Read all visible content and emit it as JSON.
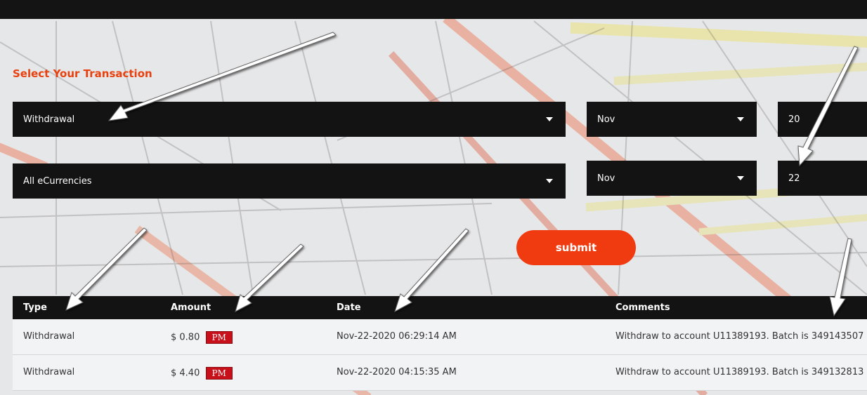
{
  "heading": "Select Your Transaction",
  "form": {
    "type_select": "Withdrawal",
    "currency_select": "All eCurrencies",
    "from_month": "Nov",
    "from_day": "20",
    "to_month": "Nov",
    "to_day": "22",
    "submit_label": "submit"
  },
  "table": {
    "headers": [
      "Type",
      "Amount",
      "Date",
      "Comments"
    ],
    "rows": [
      {
        "type": "Withdrawal",
        "amount": "$ 0.80",
        "badge": "PM",
        "date": "Nov-22-2020 06:29:14 AM",
        "comment": "Withdraw to account U11389193. Batch is 349143507"
      },
      {
        "type": "Withdrawal",
        "amount": "$ 4.40",
        "badge": "PM",
        "date": "Nov-22-2020 04:15:35 AM",
        "comment": "Withdraw to account U11389193. Batch is 349132813"
      }
    ]
  },
  "colors": {
    "accent": "#f03a10",
    "heading": "#e8400f",
    "dark": "#131313",
    "badge": "#c8101a"
  }
}
